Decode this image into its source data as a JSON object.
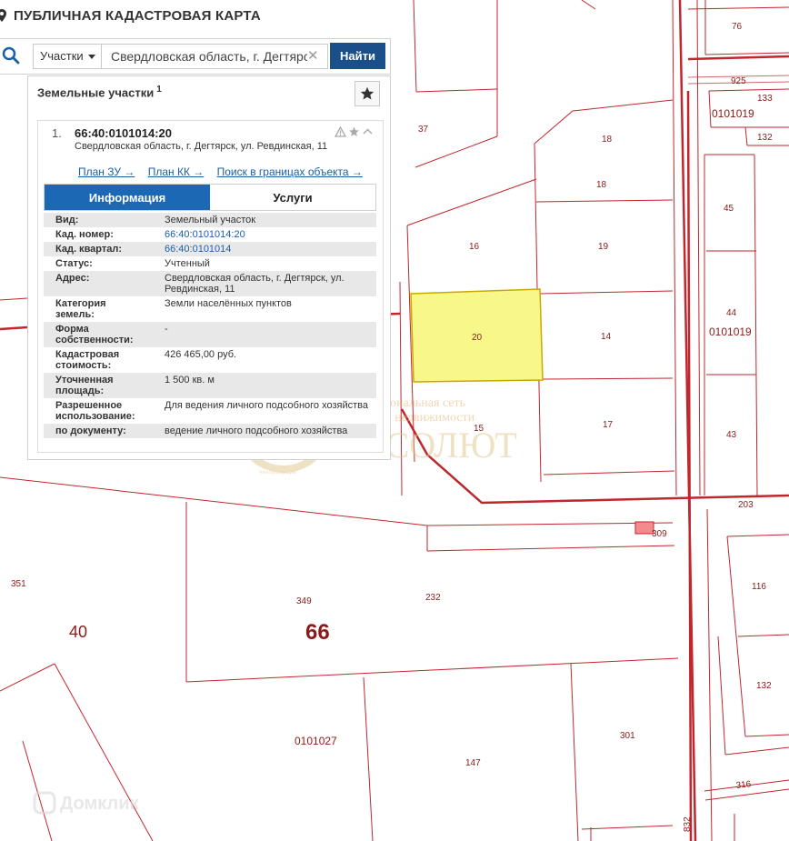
{
  "app": {
    "title": "ПУБЛИЧНАЯ КАДАСТРОВАЯ КАРТА"
  },
  "search": {
    "type_label": "Участки",
    "value": "Свердловская область, г. Дегтярск",
    "button_label": "Найти"
  },
  "panel": {
    "title": "Земельные участки",
    "count": "1",
    "result": {
      "index": "1.",
      "cadastral_number": "66:40:0101014:20",
      "address": "Свердловская область, г. Дегтярск, ул. Ревдинская, 11",
      "links": [
        "План ЗУ →",
        "План КК →",
        "Поиск в границах объекта →"
      ],
      "tabs": [
        "Информация",
        "Услуги"
      ],
      "attributes": [
        {
          "label": "Вид:",
          "value": "Земельный участок"
        },
        {
          "label": "Кад. номер:",
          "value": "66:40:0101014:20",
          "link": true
        },
        {
          "label": "Кад. квартал:",
          "value": "66:40:0101014",
          "link": true
        },
        {
          "label": "Статус:",
          "value": "Учтенный"
        },
        {
          "label": "Адрес:",
          "value": "Свердловская область, г. Дегтярск, ул. Ревдинская, 11"
        },
        {
          "label": "Категория земель:",
          "value": "Земли населённых пунктов"
        },
        {
          "label": "Форма собственности:",
          "value": "-"
        },
        {
          "label": "Кадастровая стоимость:",
          "value": "426 465,00 руб."
        },
        {
          "label": "Уточненная площадь:",
          "value": "1 500 кв. м"
        },
        {
          "label": "Разрешенное использование:",
          "value": "Для ведения личного подсобного хозяйства"
        },
        {
          "label": "по документу:",
          "value": "ведение личного подсобного хозяйства"
        }
      ]
    }
  },
  "map": {
    "colors": {
      "line": "#c0272d",
      "label": "#8b1a1a",
      "highlight": "#f8f88a",
      "highlight_border": "#c9a800"
    },
    "labels": {
      "p76": "76",
      "p925": "925",
      "p133": "133",
      "q0101019a": "0101019",
      "p132a": "132",
      "p37": "37",
      "p18a": "18",
      "p18b": "18",
      "p45": "45",
      "p16": "16",
      "p19": "19",
      "p44": "44",
      "q0101019b": "0101019",
      "p20": "20",
      "p14": "14",
      "p15": "15",
      "p17": "17",
      "p43": "43",
      "p203": "203",
      "p309": "309",
      "p351": "351",
      "p116": "116",
      "p349": "349",
      "p232": "232",
      "z40": "40",
      "z66": "66",
      "p132b": "132",
      "p301": "301",
      "q0101027": "0101027",
      "p147": "147",
      "p316": "316",
      "p832": "832"
    },
    "watermark": {
      "line1": "Региональная сеть",
      "line2": "агентств недвижимости",
      "brand": "АБСОЛЮТ",
      "seal": "Член ассоциации",
      "site": "Домклик"
    }
  }
}
